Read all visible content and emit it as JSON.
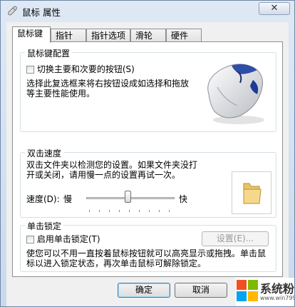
{
  "window": {
    "title": "鼠标 属性",
    "close_symbol": "✕"
  },
  "tabs": [
    {
      "label": "鼠标键",
      "active": true
    },
    {
      "label": "指针"
    },
    {
      "label": "指针选项"
    },
    {
      "label": "滑轮"
    },
    {
      "label": "硬件"
    }
  ],
  "button_config": {
    "group_title": "鼠标键配置",
    "switch_label": "切换主要和次要的按钮(S)",
    "switch_checked": false,
    "description": "选择此复选框来将右按钮设成如选择和拖放等主要性能使用。"
  },
  "double_click": {
    "group_title": "双击速度",
    "description": "双击文件夹以检测您的设置。如果文件夹没打开或关闭，请用慢一点的设置再试一次。",
    "speed_label": "速度(D):",
    "slow_label": "慢",
    "fast_label": "快",
    "speed_fraction": 0.5
  },
  "click_lock": {
    "group_title": "单击锁定",
    "enable_label": "启用单击锁定(T)",
    "enable_checked": false,
    "settings_button": "设置(E)...",
    "description": "使您可以不用一直按着鼠标按钮就可以高亮显示或拖拽。单击鼠标以进入锁定状态，再次单击鼠标可解除锁定。"
  },
  "footer": {
    "ok": "确定",
    "cancel": "取消"
  },
  "watermark": {
    "text": "系统粉",
    "url": "www.win7999.com"
  }
}
